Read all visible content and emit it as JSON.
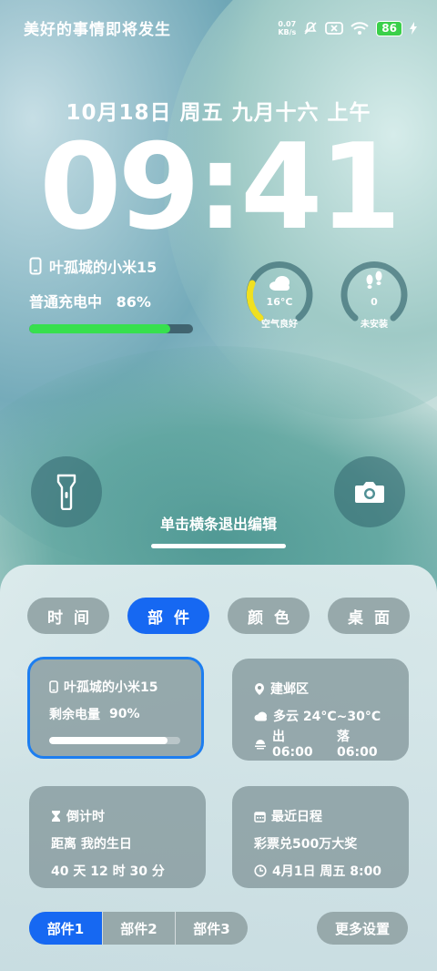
{
  "status_bar": {
    "carrier_text": "美好的事情即将发生",
    "net_speed_value": "0.07",
    "net_speed_unit": "KB/s",
    "battery": "86",
    "icons": [
      "mute-icon",
      "sim-off-icon",
      "wifi-icon",
      "battery-icon",
      "charging-icon"
    ]
  },
  "lock": {
    "date_line": "10月18日  周五  九月十六  上午",
    "time": "09:41",
    "device_name": "叶孤城的小米15",
    "charge_status": "普通充电中",
    "charge_percent": "86%",
    "charge_level": 0.86,
    "weather_temp": "16°C",
    "weather_text": "空气良好",
    "steps_value": "0",
    "steps_text": "未安装",
    "edit_hint": "单击横条退出编辑"
  },
  "tabs": [
    {
      "label": "时间",
      "active": false
    },
    {
      "label": "部件",
      "active": true
    },
    {
      "label": "颜色",
      "active": false
    },
    {
      "label": "桌面",
      "active": false
    }
  ],
  "cards": {
    "battery": {
      "device": "叶孤城的小米15",
      "label": "剩余电量",
      "percent": "90%",
      "level": 0.9
    },
    "weather": {
      "district": "建邺区",
      "condition": "多云 24°C~30°C",
      "sunrise": "出 06:00",
      "sunset": "落 06:00"
    },
    "countdown": {
      "title": "倒计时",
      "event": "距离  我的生日",
      "remaining": "40 天 12 时 30 分"
    },
    "schedule": {
      "title": "最近日程",
      "event": "彩票兑500万大奖",
      "time": "4月1日  周五  8:00"
    }
  },
  "segments": [
    {
      "label": "部件1",
      "active": true
    },
    {
      "label": "部件2",
      "active": false
    },
    {
      "label": "部件3",
      "active": false
    }
  ],
  "more_settings": "更多设置",
  "colors": {
    "accent": "#1668f2",
    "charge": "#37e04e",
    "gauge_yellow": "#f0e020"
  }
}
